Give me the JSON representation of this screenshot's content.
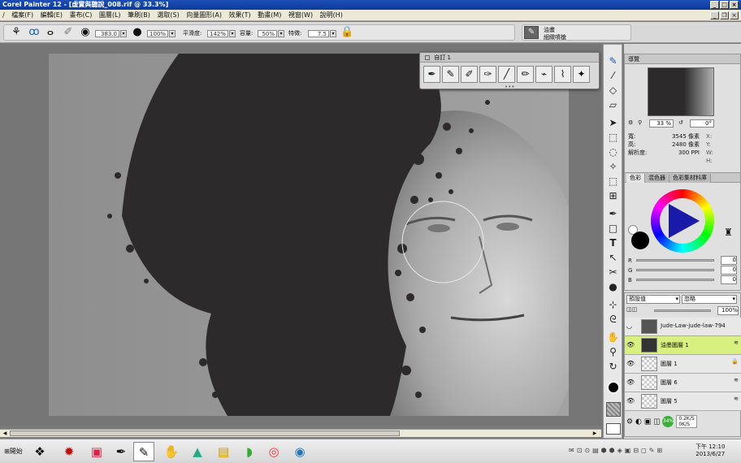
{
  "window": {
    "title": "Corel Painter 12 - [虛實與聽說_008.rif @ 33.3%]"
  },
  "menu": {
    "items": [
      "檔案(F)",
      "編輯(E)",
      "畫布(C)",
      "圖層(L)",
      "筆刷(B)",
      "選取(S)",
      "向量圖形(A)",
      "效果(T)",
      "動畫(M)",
      "視窗(W)",
      "說明(H)"
    ]
  },
  "property_bar": {
    "size_value": "383.0",
    "opacity_value": "100%",
    "smoothing_label": "平滑度:",
    "smoothing_value": "142%",
    "tolerance_label": "容量:",
    "tolerance_value": "50%",
    "feature_label": "特徵:",
    "feature_value": "7.5",
    "brush_category": "油畫",
    "brush_variant": "細緻噴槍"
  },
  "brush_palette": {
    "title": "自訂 1"
  },
  "navigator": {
    "title": "導覽",
    "zoom": "33 %",
    "rotation": "0°",
    "width_label": "寬:",
    "width_value": "3545 像素",
    "height_label": "高:",
    "height_value": "2480 像素",
    "resolution_label": "解析度:",
    "resolution_value": "300 PPI",
    "x_label": "X:",
    "y_label": "Y:",
    "w_label": "W:",
    "h_label": "H:"
  },
  "color_panel": {
    "tabs": [
      "色彩",
      "混色器",
      "色彩集材料庫"
    ],
    "r_label": "R",
    "g_label": "G",
    "b_label": "B",
    "r_value": "0",
    "g_value": "0",
    "b_value": "0"
  },
  "layers_panel": {
    "composite_method": "預設值",
    "composite_depth": "忽略",
    "opacity": "100%",
    "layers": [
      {
        "name": "Jude-Law-jude-law-794",
        "selected": false
      },
      {
        "name": "油墨圖層 1",
        "selected": true
      },
      {
        "name": "圖層 1",
        "selected": false
      },
      {
        "name": "圖層 6",
        "selected": false
      },
      {
        "name": "圖層 5",
        "selected": false
      }
    ],
    "net_up": "0.2K/S",
    "net_down": "0K/S",
    "net_percent": "34%"
  },
  "taskbar": {
    "start_label": "開始",
    "time": "下午 12:10",
    "date": "2013/6/27"
  },
  "colors": {
    "selected_layer": "#d8f080",
    "titlebar": "#0a3a9a"
  }
}
